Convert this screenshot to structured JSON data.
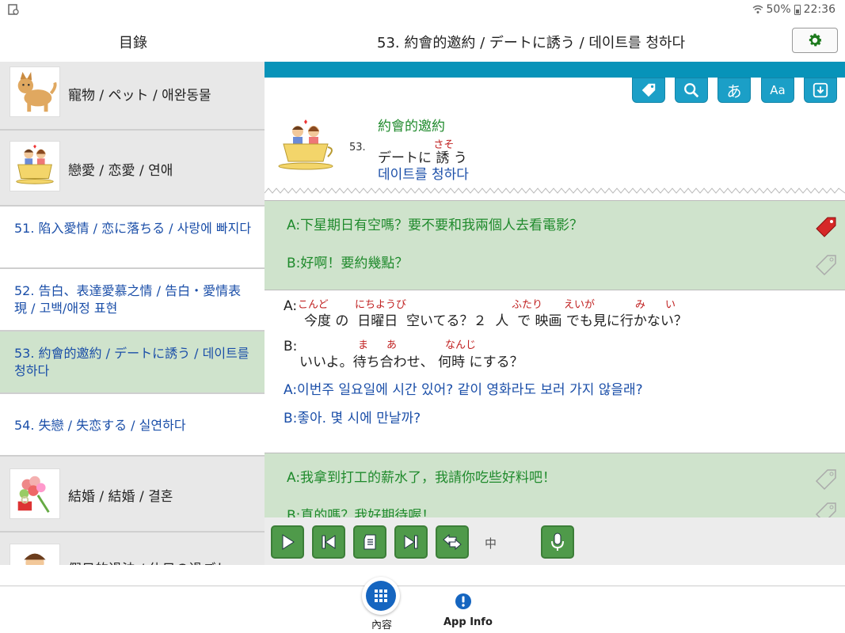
{
  "status": {
    "battery": "50%",
    "time": "22:36"
  },
  "header": {
    "toc_title": "目錄",
    "lesson_title": "53. 約會的邀約 / デートに誘う / 데이트를 청하다"
  },
  "sidebar": {
    "items": [
      {
        "label": "寵物 / ペット / 애완동물",
        "icon": "dog-icon"
      },
      {
        "label": "戀愛 / 恋愛 / 연애",
        "icon": "couple-in-cup-icon"
      },
      {
        "label": "51. 陷入愛情 / 恋に落ちる / 사랑에 빠지다"
      },
      {
        "label": "52. 告白、表達愛慕之情 / 告白・愛情表現 / 고백/애정 표현"
      },
      {
        "label": "53. 約會的邀約 / デートに誘う / 데이트를 청하다"
      },
      {
        "label": "54. 失戀 / 失恋する / 실연하다"
      },
      {
        "label": "結婚 / 結婚 / 결혼",
        "icon": "wedding-bouquet-icon"
      },
      {
        "label": "假日的過法 / 休日の過ごし",
        "icon": "person-icon"
      }
    ]
  },
  "toolbar": {
    "hiragana_label": "あ",
    "font_label": "Aa"
  },
  "lesson": {
    "number": "53.",
    "zh": "約會的邀約",
    "jp_prefix": "デートに ",
    "jp_kanji": "誘",
    "jp_suffix": " う",
    "jp_ruby": "さそ",
    "ko": "데이트를 청하다"
  },
  "dialog1": {
    "a_prefix": "A:",
    "a_zh": "下星期日有空嗎？要不要和我兩個人去看電影？",
    "b_prefix": "B:",
    "b_zh": "好啊！要約幾點？",
    "a_jp": "今度 の  日曜日  空いてる？２  人  で 映画 でも見に行かない？",
    "a_ruby": [
      "こんど",
      "にちようび",
      "ふたり",
      "えいが",
      "み",
      "い"
    ],
    "b_jp": "いいよ。待ち合わせ、 何時 にする？",
    "b_ruby": [
      "ま",
      "あ",
      "なんじ"
    ],
    "a_ko": "A:이번주 일요일에 시간 있어? 같이 영화라도 보러 가지 않을래?",
    "b_ko": "B:좋아. 몇 시에 만날까?"
  },
  "dialog2": {
    "a_zh": "A:我拿到打工的薪水了，我請你吃些好料吧！",
    "b_zh": "B:真的嗎？我好期待喔！"
  },
  "controls": {
    "speed": "中"
  },
  "bottom_nav": {
    "contents_label": "內容",
    "app_info_label": "App Info"
  },
  "colors": {
    "teal": "#0793b9",
    "tool_button": "#1b9fc7",
    "green_row": "#cfe3cc",
    "control_green": "#4f9a4a",
    "link_blue": "#1a4ea8",
    "ruby_red": "#c02020"
  }
}
